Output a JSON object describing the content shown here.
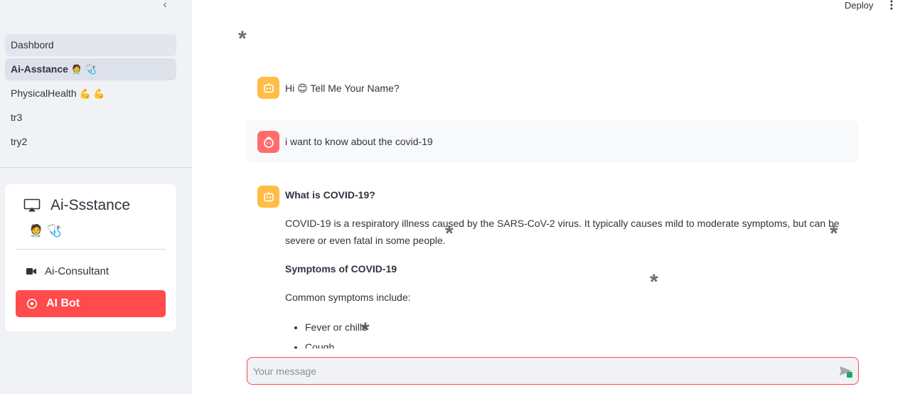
{
  "sidebar": {
    "collapse_glyph": "‹",
    "nav": [
      {
        "label": "Dashbord",
        "emoji": ""
      },
      {
        "label": "Ai-Asstance",
        "emoji": "🧑‍⚕️ 🩺"
      },
      {
        "label": "PhysicalHealth",
        "emoji": "💪 💪"
      },
      {
        "label": "tr3",
        "emoji": ""
      },
      {
        "label": "try2",
        "emoji": ""
      }
    ],
    "menu": {
      "title": "Ai-Ssstance",
      "subtitle_emoji": "🧑‍⚕️ 🩺",
      "items": [
        {
          "label": "Ai-Consultant",
          "icon": "video-camera-icon"
        },
        {
          "label": "AI Bot",
          "icon": "record-circle-icon"
        }
      ]
    }
  },
  "header": {
    "deploy_label": "Deploy"
  },
  "chat": {
    "messages": [
      {
        "role": "assistant",
        "avatar": "bot-icon",
        "greeting": "Hi",
        "emoji": "😊",
        "text": "Tell Me Your Name?"
      },
      {
        "role": "user",
        "avatar": "user-face-icon",
        "text": "i want to know about the covid-19"
      }
    ],
    "answer": {
      "heading": "What is COVID-19?",
      "intro": "COVID-19 is a respiratory illness caused by the SARS-CoV-2 virus. It typically causes mild to moderate symptoms, but can be severe or even fatal in some people.",
      "symptoms_heading": "Symptoms of COVID-19",
      "symptoms_intro": "Common symptoms include:",
      "symptoms": [
        "Fever or chills",
        "Cough"
      ]
    },
    "input_placeholder": "Your message",
    "star_glyph": "*"
  },
  "colors": {
    "accent": "#ff4b4b",
    "bot_avatar": "#ffbd45",
    "user_avatar": "#ff6c6c",
    "sidebar_bg": "#f0f2f6"
  }
}
